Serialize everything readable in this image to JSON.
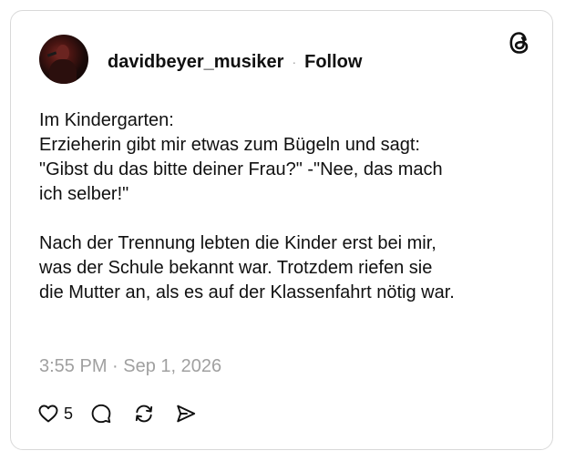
{
  "author": {
    "username": "davidbeyer_musiker",
    "separator": "·",
    "follow_label": "Follow"
  },
  "post": {
    "text": "Im Kindergarten:\nErzieherin gibt mir etwas zum Bügeln und sagt:\n\"Gibst du das bitte deiner Frau?\" -\"Nee, das mach\nich selber!\"\n\nNach der Trennung lebten die Kinder erst bei mir,\nwas der Schule bekannt war. Trotzdem riefen sie\ndie Mutter an, als es auf der Klassenfahrt nötig war.",
    "timestamp": "3:55 PM · Sep 1, 2026"
  },
  "actions": {
    "like_count": "5",
    "icons": [
      "heart-icon",
      "comment-icon",
      "repost-icon",
      "share-icon"
    ]
  },
  "colors": {
    "text": "#101010",
    "muted": "#a0a0a0",
    "border": "#d9d9d9"
  }
}
